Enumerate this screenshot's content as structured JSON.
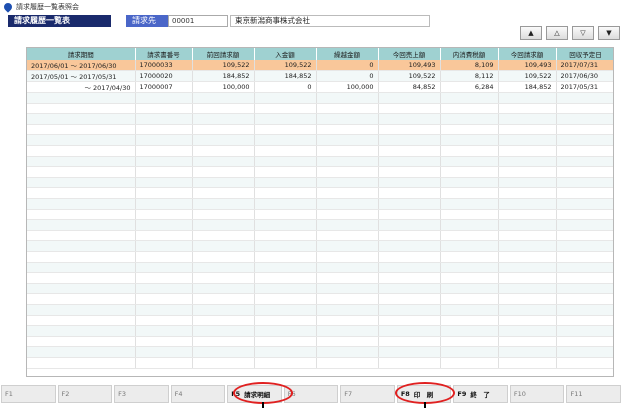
{
  "window": {
    "title": "請求履歴一覧表照会"
  },
  "header": {
    "screen_title": "請求履歴一覧表",
    "customer_label": "請求先",
    "customer_code": "00001",
    "customer_name": "東京新潟商事株式会社"
  },
  "nav": {
    "first": "▲",
    "prev": "△",
    "next": "▽",
    "last": "▼"
  },
  "grid": {
    "headers": [
      "請求期間",
      "請求書番号",
      "前回請求額",
      "入金額",
      "繰越金額",
      "今回売上額",
      "内消費税額",
      "今回請求額",
      "回収予定日"
    ],
    "rows": [
      [
        "2017/06/01 ～ 2017/06/30",
        "17000033",
        "109,522",
        "109,522",
        "0",
        "109,493",
        "8,109",
        "109,493",
        "2017/07/31"
      ],
      [
        "2017/05/01 ～ 2017/05/31",
        "17000020",
        "184,852",
        "184,852",
        "0",
        "109,522",
        "8,112",
        "109,522",
        "2017/06/30"
      ],
      [
        "～ 2017/04/30",
        "17000007",
        "100,000",
        "0",
        "100,000",
        "84,852",
        "6,284",
        "184,852",
        "2017/05/31"
      ]
    ]
  },
  "function_keys": [
    {
      "key": "F1",
      "label": ""
    },
    {
      "key": "F2",
      "label": ""
    },
    {
      "key": "F3",
      "label": ""
    },
    {
      "key": "F4",
      "label": ""
    },
    {
      "key": "F5",
      "label": "請求明細"
    },
    {
      "key": "F6",
      "label": ""
    },
    {
      "key": "F7",
      "label": ""
    },
    {
      "key": "F8",
      "label": "印　刷"
    },
    {
      "key": "F9",
      "label": "終　了"
    },
    {
      "key": "F10",
      "label": ""
    },
    {
      "key": "F11",
      "label": ""
    }
  ],
  "colors": {
    "title_bg": "#1a2a6c",
    "header_bg": "#9fd1d1",
    "selected_row": "#f9c79a",
    "highlight_ring": "#e02020"
  }
}
